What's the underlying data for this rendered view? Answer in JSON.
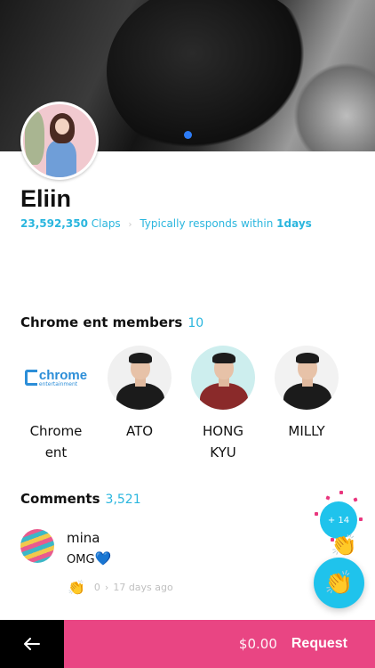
{
  "profile": {
    "name": "Eliin",
    "claps_count": "23,592,350",
    "claps_label": "Claps",
    "responds_prefix": "Typically responds within",
    "responds_value": "1days"
  },
  "members": {
    "title": "Chrome ent members",
    "count": "10",
    "items": [
      {
        "label": "Chrome\nent",
        "logo_main": "chrome",
        "logo_sub": "entertainment"
      },
      {
        "label": "ATO"
      },
      {
        "label": "HONG\nKYU"
      },
      {
        "label": "MILLY"
      }
    ]
  },
  "comments": {
    "title": "Comments",
    "count": "3,521",
    "items": [
      {
        "user": "mina",
        "text": "OMG",
        "emoji": "💙",
        "claps": "0",
        "time": "17 days ago"
      }
    ]
  },
  "floating": {
    "burst_label": "+ 14"
  },
  "bottom_bar": {
    "price": "$0.00",
    "request_label": "Request"
  },
  "colors": {
    "accent": "#2ab6de",
    "cta": "#e94583",
    "fab": "#1fc3ec"
  },
  "icons": {
    "back": "arrow-left-icon",
    "clap": "clap-icon"
  }
}
